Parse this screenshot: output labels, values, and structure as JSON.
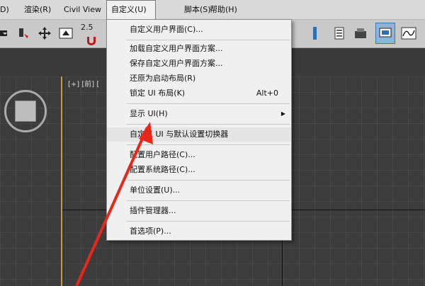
{
  "menubar": {
    "items": [
      {
        "label": "D)"
      },
      {
        "label": "渲染(R)"
      },
      {
        "label": "Civil View"
      },
      {
        "label": "自定义(U)"
      },
      {
        "label": "脚本(S)"
      },
      {
        "label": "帮助(H)"
      }
    ]
  },
  "toolbar": {
    "snap_number": "2.5"
  },
  "viewport": {
    "label": "[+] [前] ["
  },
  "dropdown": {
    "items": [
      {
        "label": "自定义用户界面(C)..."
      },
      {
        "label": "加载自定义用户界面方案..."
      },
      {
        "label": "保存自定义用户界面方案..."
      },
      {
        "label": "还原为启动布局(R)"
      },
      {
        "label": "锁定 UI 布局(K)",
        "shortcut": "Alt+0"
      },
      {
        "label": "显示 UI(H)",
        "submenu": "▶"
      },
      {
        "label": "自定义 UI 与默认设置切换器"
      },
      {
        "label": "配置用户路径(C)..."
      },
      {
        "label": "配置系统路径(C)..."
      },
      {
        "label": "单位设置(U)..."
      },
      {
        "label": "插件管理器..."
      },
      {
        "label": "首选项(P)..."
      }
    ]
  },
  "colors": {
    "annotation_arrow": "#e8261a",
    "selected_button": "#8fb4d8"
  }
}
